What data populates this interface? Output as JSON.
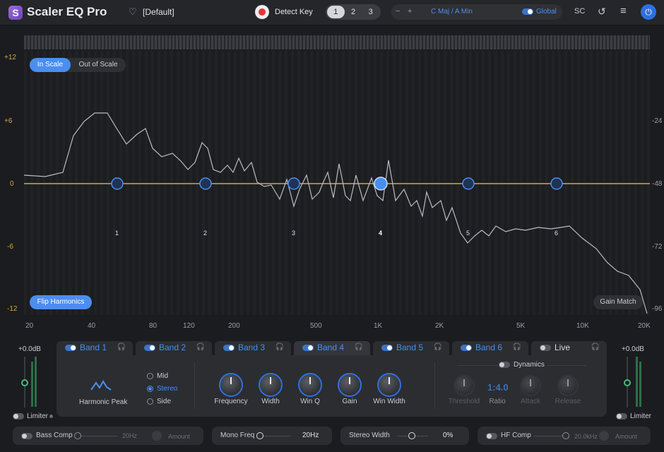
{
  "topbar": {
    "app_title": "Scaler EQ Pro",
    "preset": "[Default]",
    "detect_key": "Detect Key",
    "slots": [
      "1",
      "2",
      "3"
    ],
    "key_minus": "−",
    "key_plus": "+",
    "key": "C Maj / A Min",
    "global": "Global",
    "sc": "SC"
  },
  "graph": {
    "in_scale": "In Scale",
    "out_of_scale": "Out of Scale",
    "flip_harmonics": "Flip Harmonics",
    "gain_match": "Gain Match",
    "y_left": [
      "+12",
      "+6",
      "0",
      "-6",
      "-12"
    ],
    "y_right": [
      "-24",
      "-48",
      "-72",
      "-96"
    ],
    "x_ticks": [
      "20",
      "40",
      "80",
      "120",
      "200",
      "500",
      "1K",
      "2K",
      "5K",
      "10K",
      "20K"
    ],
    "nodes": [
      "1",
      "2",
      "3",
      "4",
      "5",
      "6"
    ]
  },
  "bands": {
    "tabs": [
      "Band 1",
      "Band 2",
      "Band 3",
      "Band 4",
      "Band 5",
      "Band 6",
      "Live"
    ],
    "shape": "Harmonic Peak",
    "modes": [
      "Mid",
      "Stereo",
      "Side"
    ],
    "knobs": [
      "Frequency",
      "Width",
      "Win Q",
      "Gain",
      "Win Width"
    ],
    "dynamics": "Dynamics",
    "dyn_knobs": [
      "Threshold",
      "Ratio",
      "Attack",
      "Release"
    ],
    "ratio_value": "1:4.0"
  },
  "side": {
    "left_db": "+0.0dB",
    "right_db": "+0.0dB",
    "limiter": "Limiter"
  },
  "bottom": {
    "bass_comp": "Bass Comp",
    "bass_freq": "20Hz",
    "amount": "Amount",
    "mono_freq": "Mono Freq",
    "mono_value": "20Hz",
    "stereo_width": "Stereo Width",
    "stereo_value": "0%",
    "hf_comp": "HF Comp",
    "hf_freq": "20.0kHz",
    "hf_amount": "Amount"
  }
}
